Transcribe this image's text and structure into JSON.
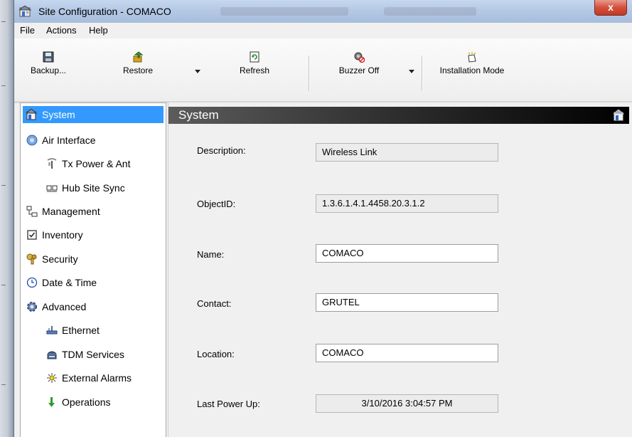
{
  "window": {
    "title": "Site Configuration - COMACO",
    "close_label": "x"
  },
  "menu": {
    "items": [
      "File",
      "Actions",
      "Help"
    ]
  },
  "toolbar": {
    "backup": "Backup...",
    "restore": "Restore",
    "refresh": "Refresh",
    "buzzer_off": "Buzzer Off",
    "installation_mode": "Installation Mode"
  },
  "nav": {
    "items": [
      {
        "label": "System",
        "icon": "system-icon",
        "selected": true
      },
      {
        "label": "Air Interface",
        "icon": "air-interface-icon"
      },
      {
        "label": "Tx Power & Ant",
        "icon": "antenna-icon"
      },
      {
        "label": "Hub Site Sync",
        "icon": "sync-icon"
      },
      {
        "label": "Management",
        "icon": "management-icon"
      },
      {
        "label": "Inventory",
        "icon": "inventory-icon"
      },
      {
        "label": "Security",
        "icon": "key-icon"
      },
      {
        "label": "Date & Time",
        "icon": "clock-icon"
      },
      {
        "label": "Advanced",
        "icon": "gear-icon"
      },
      {
        "label": "Ethernet",
        "icon": "ethernet-icon"
      },
      {
        "label": "TDM Services",
        "icon": "tdm-icon"
      },
      {
        "label": "External Alarms",
        "icon": "alarm-icon"
      },
      {
        "label": "Operations",
        "icon": "down-arrow-icon"
      }
    ]
  },
  "panel": {
    "title": "System",
    "fields": [
      {
        "label": "Description:",
        "value": "Wireless Link",
        "editable": false
      },
      {
        "label": "ObjectID:",
        "value": "1.3.6.1.4.1.4458.20.3.1.2",
        "editable": false
      },
      {
        "label": "Name:",
        "value": "COMACO",
        "editable": true
      },
      {
        "label": "Contact:",
        "value": "GRUTEL",
        "editable": true
      },
      {
        "label": "Location:",
        "value": "COMACO",
        "editable": true
      },
      {
        "label": "Last Power Up:",
        "value": "3/10/2016 3:04:57 PM",
        "editable": false
      }
    ]
  },
  "colors": {
    "selection": "#3399ff",
    "header_dark": "#000000"
  }
}
